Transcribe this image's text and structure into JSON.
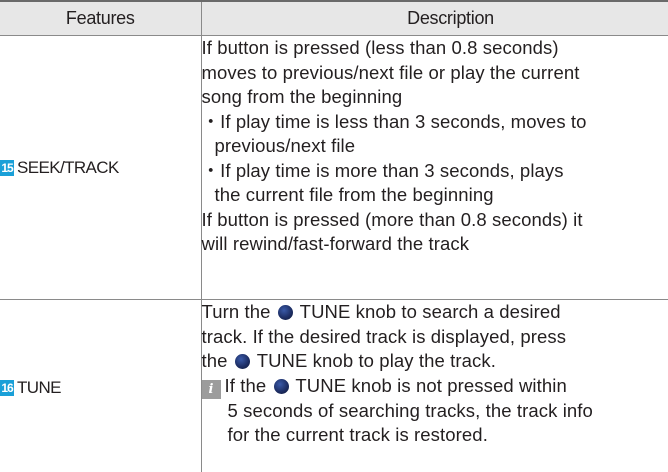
{
  "table": {
    "headers": {
      "features": "Features",
      "description": "Description"
    },
    "rows": [
      {
        "number": "15",
        "feature": "SEEK/TRACK",
        "desc": {
          "l1": "If button is pressed (less than 0.8 seconds)",
          "l2": "moves to previous/next file or play the current",
          "l3": "song from the beginning",
          "b1a": "・If play time is less than 3 seconds, moves to",
          "b1b": "previous/next file",
          "b2a": "・If play time is more than 3 seconds, plays",
          "b2b": "the current file from the beginning",
          "l4": "If button is pressed (more than 0.8 seconds) it",
          "l5": "will rewind/fast-forward the track"
        }
      },
      {
        "number": "16",
        "feature": "TUNE",
        "desc": {
          "l1_pre": "Turn the",
          "l1_post": "TUNE knob to search a desired",
          "l2": "track. If the desired track is displayed, press",
          "l3_pre": "the",
          "l3_post": "TUNE knob to play the track.",
          "note_icon": "i",
          "note_l1_pre": "If the",
          "note_l1_post": "TUNE knob is not pressed within",
          "note_l2": "5 seconds of searching tracks, the track info",
          "note_l3": "for the current track is restored."
        }
      }
    ]
  },
  "colors": {
    "header_bg": "#e7e7e7",
    "badge": "#1aa0d8",
    "knob": "#1e2f66",
    "info_icon": "#9c9c9c",
    "border": "#8a8a8a"
  },
  "icons": {
    "knob": "tune-knob-icon",
    "info": "info-icon"
  }
}
